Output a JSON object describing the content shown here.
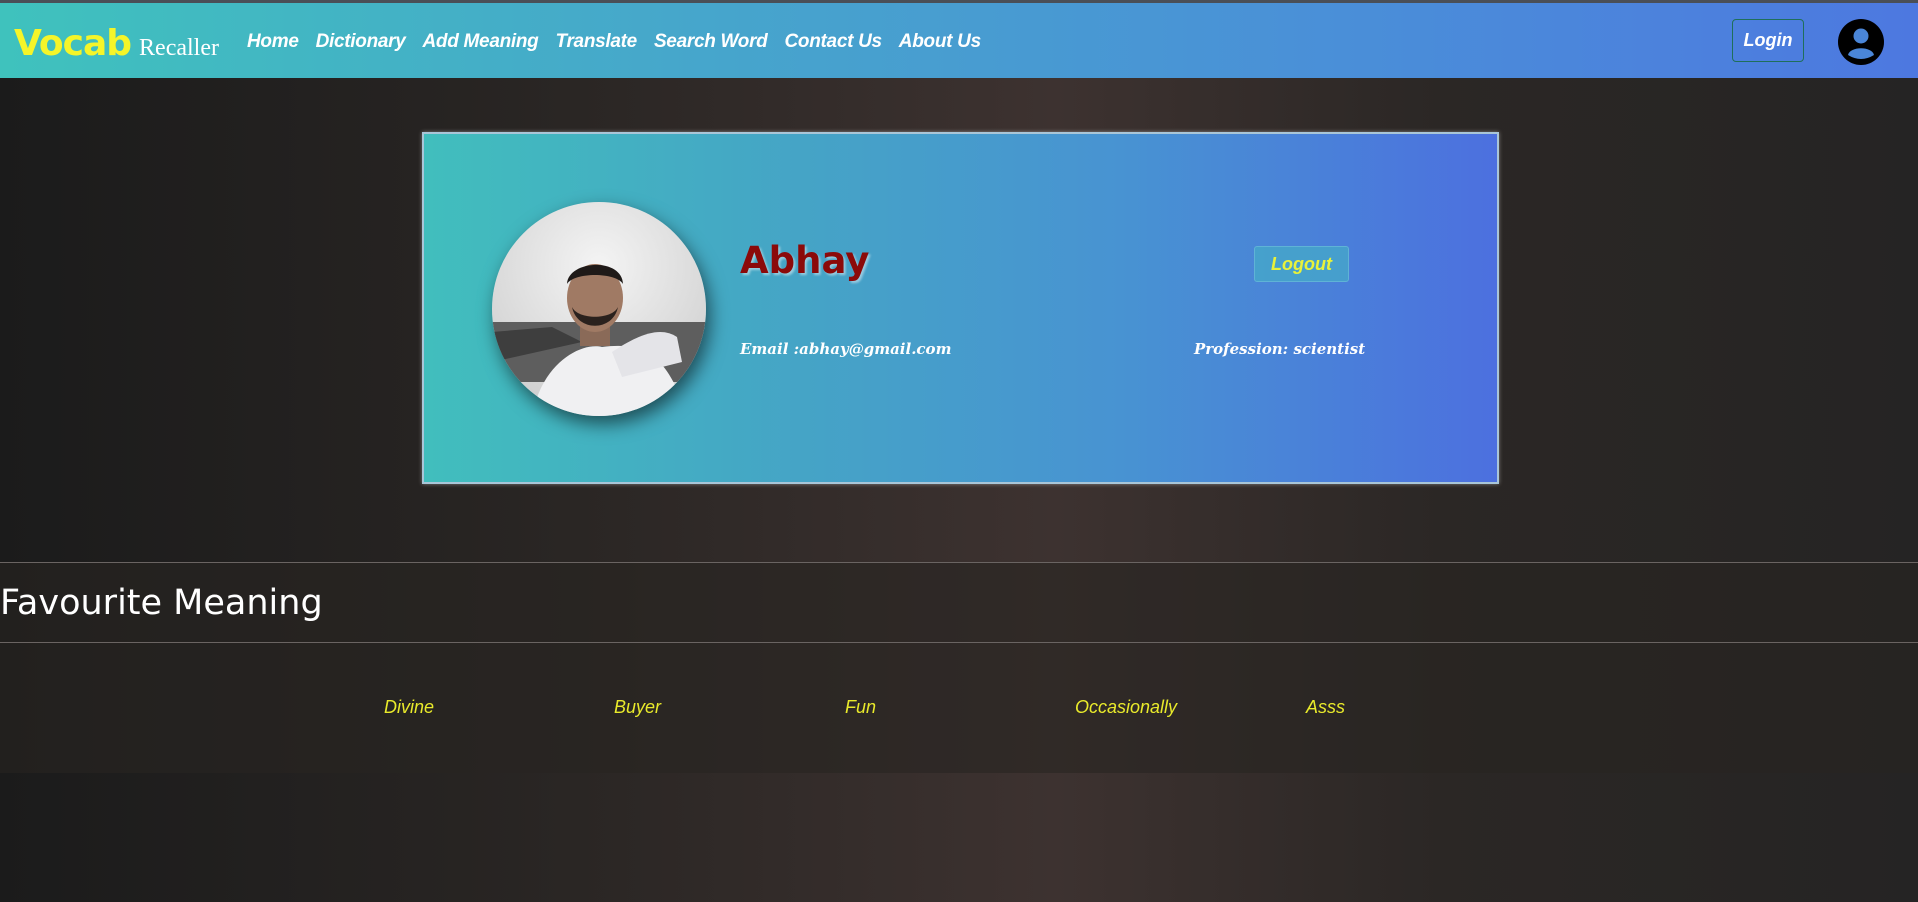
{
  "brand": {
    "main": "Vocab",
    "sub": "Recaller"
  },
  "nav": {
    "links": [
      "Home",
      "Dictionary",
      "Add Meaning",
      "Translate",
      "Search Word",
      "Contact Us",
      "About Us"
    ],
    "login_label": "Login",
    "account_icon": "user-circle-icon"
  },
  "profile": {
    "name": "Abhay",
    "logout_label": "Logout",
    "email_text": "Email :abhay@gmail.com",
    "profession_text": "Profession: scientist"
  },
  "favourites": {
    "title": "Favourite Meaning",
    "words": [
      "Divine",
      "Buyer",
      "Fun",
      "Occasionally",
      "Asss"
    ]
  },
  "colors": {
    "accent_yellow": "#f5f529",
    "name_red": "#8b0a0a",
    "nav_gradient_start": "#3fc2bd",
    "nav_gradient_end": "#4d78e0"
  }
}
